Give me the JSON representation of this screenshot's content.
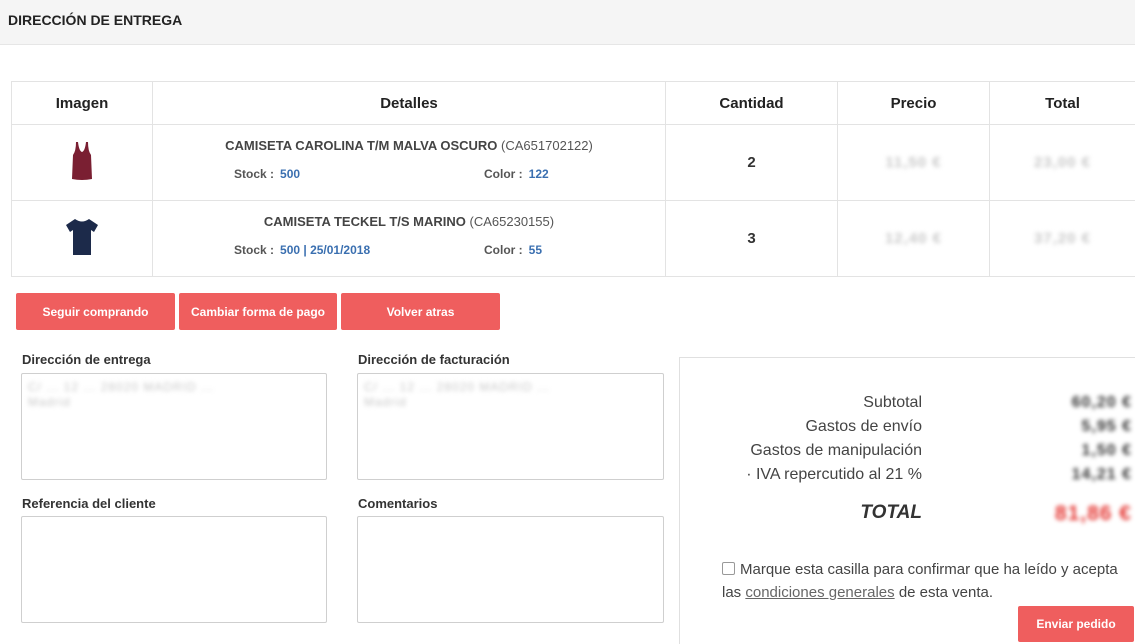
{
  "header": {
    "title": "DIRECCIÓN DE ENTREGA"
  },
  "table": {
    "columns": [
      "Imagen",
      "Detalles",
      "Cantidad",
      "Precio",
      "Total"
    ],
    "rows": [
      {
        "product_name": "CAMISETA CAROLINA T/M MALVA OSCURO",
        "code": "(CA651702122)",
        "stock_label": "Stock :",
        "stock_value": "500",
        "color_label": "Color :",
        "color_value": "122",
        "quantity": "2",
        "price": "11,50 €",
        "total": "23,00 €",
        "image_color": "#7a1f32"
      },
      {
        "product_name": "CAMISETA TECKEL T/S MARINO",
        "code": "(CA65230155)",
        "stock_label": "Stock :",
        "stock_value": "500 | 25/01/2018",
        "color_label": "Color :",
        "color_value": "55",
        "quantity": "3",
        "price": "12,40 €",
        "total": "37,20 €",
        "image_color": "#1c2a4a"
      }
    ]
  },
  "buttons": {
    "continue": "Seguir comprando",
    "change_payment": "Cambiar forma de pago",
    "back": "Volver atras",
    "submit": "Enviar pedido"
  },
  "form": {
    "delivery_label": "Dirección de entrega",
    "delivery_value_line1": "C/ ... 12 ... 28020 MADRID ...",
    "delivery_value_line2": "Madrid",
    "billing_label": "Dirección de facturación",
    "billing_value_line1": "C/ ... 12 ... 28020 MADRID ...",
    "billing_value_line2": "Madrid",
    "reference_label": "Referencia del cliente",
    "comments_label": "Comentarios"
  },
  "summary": {
    "subtotal_label": "Subtotal",
    "subtotal_value": "60,20 €",
    "shipping_label": "Gastos de envío",
    "shipping_value": "5,95 €",
    "handling_label": "Gastos de manipulación",
    "handling_value": "1,50 €",
    "vat_label": "· IVA repercutido al 21 %",
    "vat_value": "14,21 €",
    "total_label": "TOTAL",
    "total_value": "81,86 €"
  },
  "terms": {
    "text_before": "Marque esta casilla para confirmar que ha leído y acepta las",
    "link": "condiciones generales",
    "text_after": "de esta venta."
  },
  "colors": {
    "accent": "#ef5e5e",
    "link_blue": "#3a6fb0",
    "total_red": "#e53935"
  }
}
